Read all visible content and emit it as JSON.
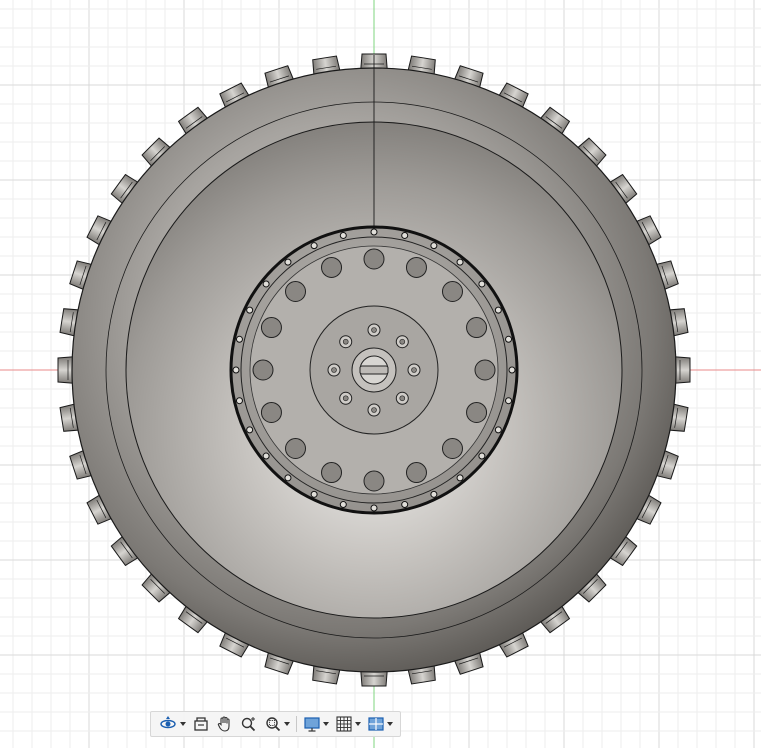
{
  "viewport": {
    "background": "#ffffff",
    "grid_minor_color": "#eeeeee",
    "grid_major_color": "#d9d9d9",
    "axis_x_color": "#e88a8a",
    "axis_y_color": "#7fd67f"
  },
  "model": {
    "name": "wheel",
    "tire_tread_lug_count": 40,
    "rim_outer_bolt_count": 28,
    "rim_hole_ring_count": 16,
    "hub_bolt_count": 8,
    "tire_color": "#8f8c88",
    "edge_color": "#1a1a1a"
  },
  "toolbar": {
    "items": [
      {
        "name": "orbit-tool",
        "icon": "orbit-icon",
        "has_dropdown": true
      },
      {
        "name": "look-at-tool",
        "icon": "look-at-icon",
        "has_dropdown": false
      },
      {
        "name": "pan-tool",
        "icon": "pan-hand-icon",
        "has_dropdown": false
      },
      {
        "name": "zoom-tool",
        "icon": "zoom-icon",
        "has_dropdown": false
      },
      {
        "name": "fit-tool",
        "icon": "zoom-fit-icon",
        "has_dropdown": true
      },
      {
        "name": "display-settings",
        "icon": "display-icon",
        "has_dropdown": true
      },
      {
        "name": "grid-settings",
        "icon": "grid-icon",
        "has_dropdown": true
      },
      {
        "name": "viewports",
        "icon": "viewports-icon",
        "has_dropdown": true
      }
    ]
  }
}
